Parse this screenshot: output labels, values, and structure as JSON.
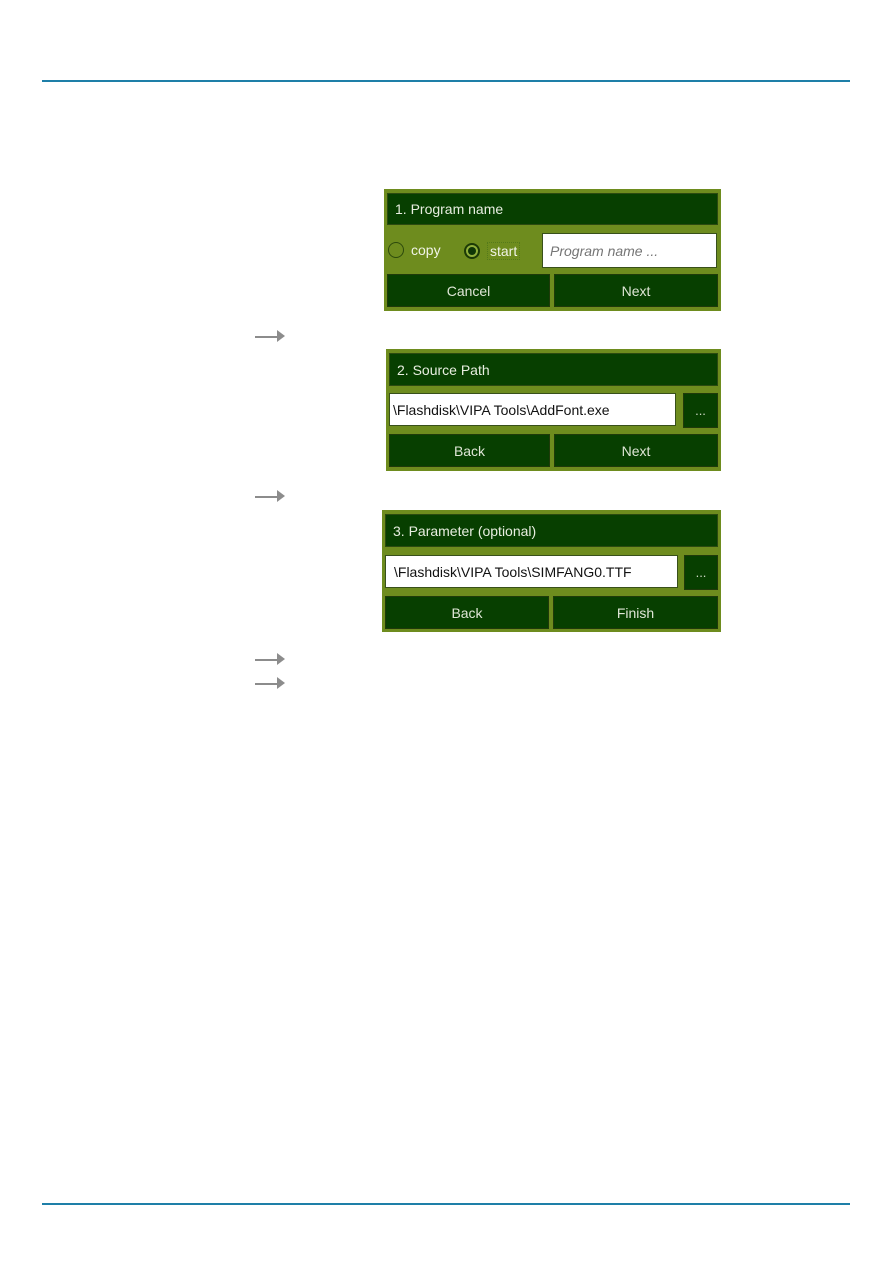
{
  "page": {
    "colors": {
      "rule": "#1e7fa8",
      "dialog_frame": "#6e8c1e",
      "dialog_dark": "#073f00",
      "arrow": "#8c8c8c"
    }
  },
  "steps": [
    {
      "title": "1. Program name",
      "radios": [
        {
          "label": "copy",
          "selected": false
        },
        {
          "label": "start",
          "selected": true
        }
      ],
      "input": {
        "value": "",
        "placeholder": "Program name ..."
      },
      "buttons": {
        "left": "Cancel",
        "right": "Next"
      }
    },
    {
      "title": "2. Source Path",
      "input": {
        "value": "\\Flashdisk\\VIPA Tools\\AddFont.exe",
        "placeholder": ""
      },
      "browse_label": "...",
      "buttons": {
        "left": "Back",
        "right": "Next"
      }
    },
    {
      "title": "3. Parameter (optional)",
      "input": {
        "value": "\\Flashdisk\\VIPA Tools\\SIMFANG0.TTF",
        "placeholder": ""
      },
      "browse_label": "...",
      "buttons": {
        "left": "Back",
        "right": "Finish"
      }
    }
  ],
  "arrows": [
    {
      "icon": "arrow-right-icon"
    },
    {
      "icon": "arrow-right-icon"
    },
    {
      "icon": "arrow-right-icon"
    },
    {
      "icon": "arrow-right-icon"
    }
  ]
}
